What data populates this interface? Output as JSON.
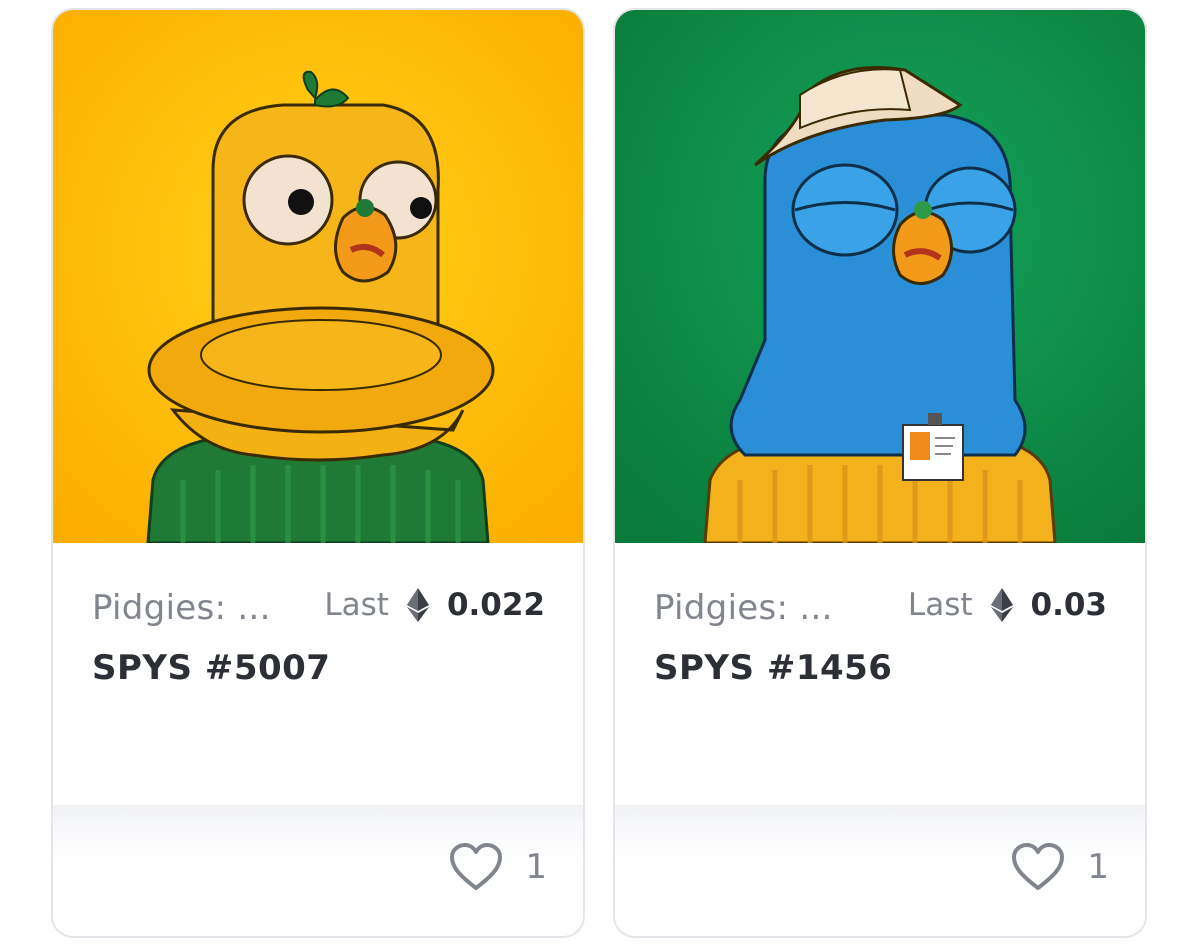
{
  "cards": [
    {
      "collection": "Pidgies: ...",
      "last_label": "Last",
      "price": "0.022",
      "currency_icon": "ethereum-icon",
      "name": "SPYS #5007",
      "likes": "1",
      "like_icon": "heart-outline-icon",
      "art_background": "#fdb500",
      "bird_color": "#f6b61a",
      "sweater_color": "#1f7a35"
    },
    {
      "collection": "Pidgies: ...",
      "last_label": "Last",
      "price": "0.03",
      "currency_icon": "ethereum-icon",
      "name": "SPYS #1456",
      "likes": "1",
      "like_icon": "heart-outline-icon",
      "art_background": "#0f8f4a",
      "bird_color": "#2b8fd8",
      "sweater_color": "#f3b21c"
    }
  ]
}
